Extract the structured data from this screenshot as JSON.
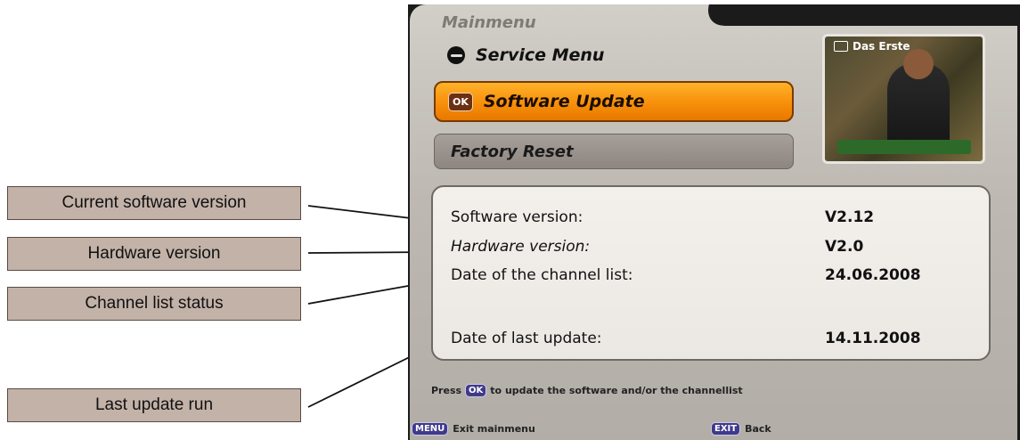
{
  "annotations": [
    {
      "label": "Current software version"
    },
    {
      "label": "Hardware version"
    },
    {
      "label": "Channel list status"
    },
    {
      "label": "Last update run"
    }
  ],
  "menu": {
    "title": "Mainmenu",
    "section": "Service Menu",
    "items": [
      {
        "label": "Software Update",
        "badge": "OK",
        "selected": true
      },
      {
        "label": "Factory Reset",
        "selected": false
      }
    ]
  },
  "preview": {
    "channel": "Das Erste",
    "icon": "tv-icon"
  },
  "info": [
    {
      "label": "Software version:",
      "value": "V2.12"
    },
    {
      "label": "Hardware version:",
      "value": "V2.0"
    },
    {
      "label": "Date of the channel list:",
      "value": "24.06.2008"
    },
    {
      "label": "Date of last update:",
      "value": "14.11.2008"
    }
  ],
  "hint": {
    "prefix": "Press",
    "key": "OK",
    "text": "to update the software and/or the channellist"
  },
  "footer": [
    {
      "key": "MENU",
      "label": "Exit mainmenu"
    },
    {
      "key": "EXIT",
      "label": "Back"
    }
  ],
  "colors": {
    "callout_bg": "#c3b2a8",
    "highlight": "#f78f0a",
    "panel": "#c6c1bb"
  }
}
